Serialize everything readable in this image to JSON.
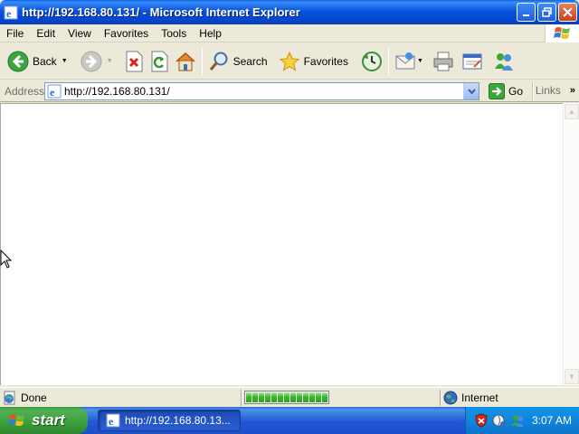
{
  "window": {
    "title": "http://192.168.80.131/ - Microsoft Internet Explorer"
  },
  "menu": {
    "items": [
      {
        "label": "File"
      },
      {
        "label": "Edit"
      },
      {
        "label": "View"
      },
      {
        "label": "Favorites"
      },
      {
        "label": "Tools"
      },
      {
        "label": "Help"
      }
    ]
  },
  "toolbar": {
    "back_label": "Back",
    "search_label": "Search",
    "favorites_label": "Favorites"
  },
  "address": {
    "label": "Address",
    "value": "http://192.168.80.131/",
    "go_label": "Go",
    "links_label": "Links"
  },
  "status": {
    "text": "Done",
    "progress": 1.0,
    "zone": "Internet"
  },
  "taskbar": {
    "start_label": "start",
    "task_label": "http://192.168.80.13...",
    "clock": "3:07 AM"
  },
  "colors": {
    "titlebar": "#0855DD",
    "taskbar": "#2157D7",
    "start": "#3A9E3A",
    "chrome": "#ECE9D8"
  }
}
